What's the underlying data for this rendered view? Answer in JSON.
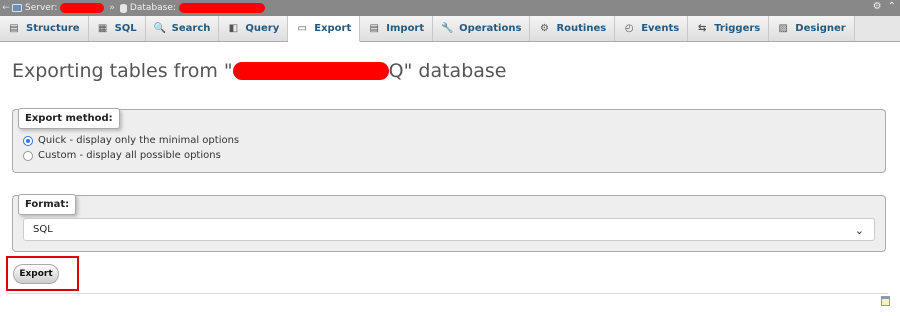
{
  "breadcrumb": {
    "back_glyph": "←",
    "server_label": "Server:",
    "separator": "»",
    "database_label": "Database:",
    "settings_glyph": "⚙",
    "collapse_glyph": "⌃"
  },
  "tabs": [
    {
      "label": "Structure",
      "icon": "structure-icon",
      "glyph": "▤",
      "active": false
    },
    {
      "label": "SQL",
      "icon": "sql-icon",
      "glyph": "▦",
      "active": false
    },
    {
      "label": "Search",
      "icon": "search-icon",
      "glyph": "🔍",
      "active": false
    },
    {
      "label": "Query",
      "icon": "query-icon",
      "glyph": "◧",
      "active": false
    },
    {
      "label": "Export",
      "icon": "export-icon",
      "glyph": "▭",
      "active": true
    },
    {
      "label": "Import",
      "icon": "import-icon",
      "glyph": "▤",
      "active": false
    },
    {
      "label": "Operations",
      "icon": "wrench-icon",
      "glyph": "🔧",
      "active": false
    },
    {
      "label": "Routines",
      "icon": "routines-icon",
      "glyph": "⚙",
      "active": false
    },
    {
      "label": "Events",
      "icon": "clock-icon",
      "glyph": "◴",
      "active": false
    },
    {
      "label": "Triggers",
      "icon": "triggers-icon",
      "glyph": "⇆",
      "active": false
    },
    {
      "label": "Designer",
      "icon": "designer-icon",
      "glyph": "▨",
      "active": false
    }
  ],
  "page": {
    "title_prefix": "Exporting tables from \"",
    "title_suffix": "Q\" database"
  },
  "export_method": {
    "legend": "Export method:",
    "options": [
      {
        "label": "Quick - display only the minimal options",
        "selected": true
      },
      {
        "label": "Custom - display all possible options",
        "selected": false
      }
    ]
  },
  "format": {
    "legend": "Format:",
    "selected": "SQL"
  },
  "export_button": "Export",
  "colors": {
    "tab_text": "#235a81",
    "highlight_box": "#e00000",
    "radio_selected": "#2b78e4"
  }
}
